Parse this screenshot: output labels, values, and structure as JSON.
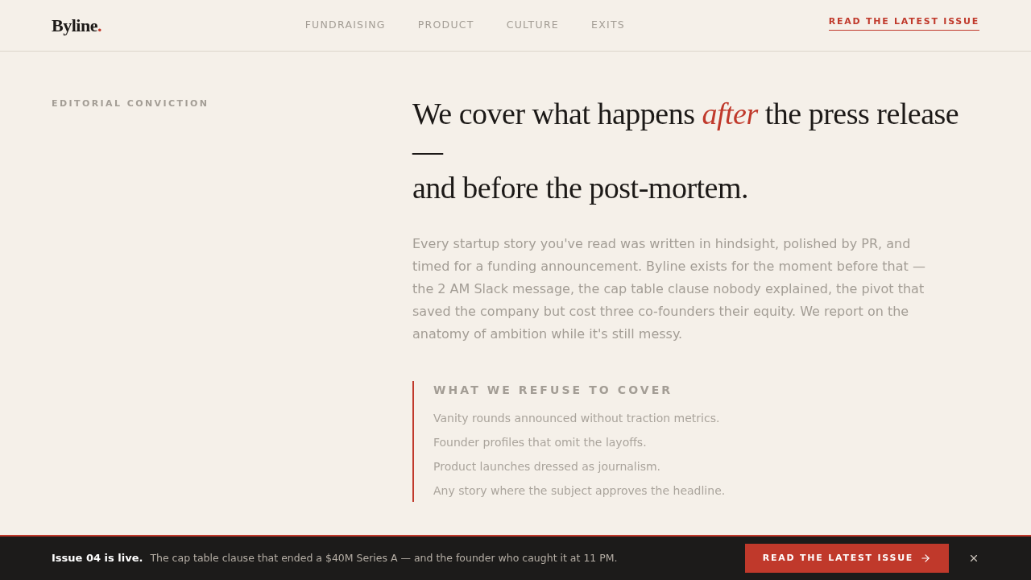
{
  "header": {
    "logo": {
      "text": "Byline",
      "accent": "."
    },
    "nav": [
      "FUNDRAISING",
      "PRODUCT",
      "CULTURE",
      "EXITS"
    ],
    "cta": "READ THE LATEST ISSUE"
  },
  "section": {
    "eyebrow": "EDITORIAL CONVICTION",
    "headline": [
      "We cover what happens *after* the press release —",
      "and before the post-mortem."
    ],
    "body": "Every startup story you've read was written in hindsight, polished by PR, and timed for a funding announcement. Byline exists for the moment before that — the 2 AM Slack message, the cap table clause nobody explained, the pivot that saved the company but cost three co-founders their equity. We report on the anatomy of ambition while it's still messy.",
    "refuse": {
      "title": "WHAT WE REFUSE TO COVER",
      "items": [
        "Vanity rounds announced without traction metrics.",
        "Founder profiles that omit the layoffs.",
        "Product launches dressed as journalism.",
        "Any story where the subject approves the headline."
      ]
    }
  },
  "banner": {
    "lead": "Issue 04 is live.",
    "message": "The cap table clause that ended a $40M Series A — and the founder who caught it at 11 PM.",
    "button": "READ THE LATEST ISSUE"
  }
}
